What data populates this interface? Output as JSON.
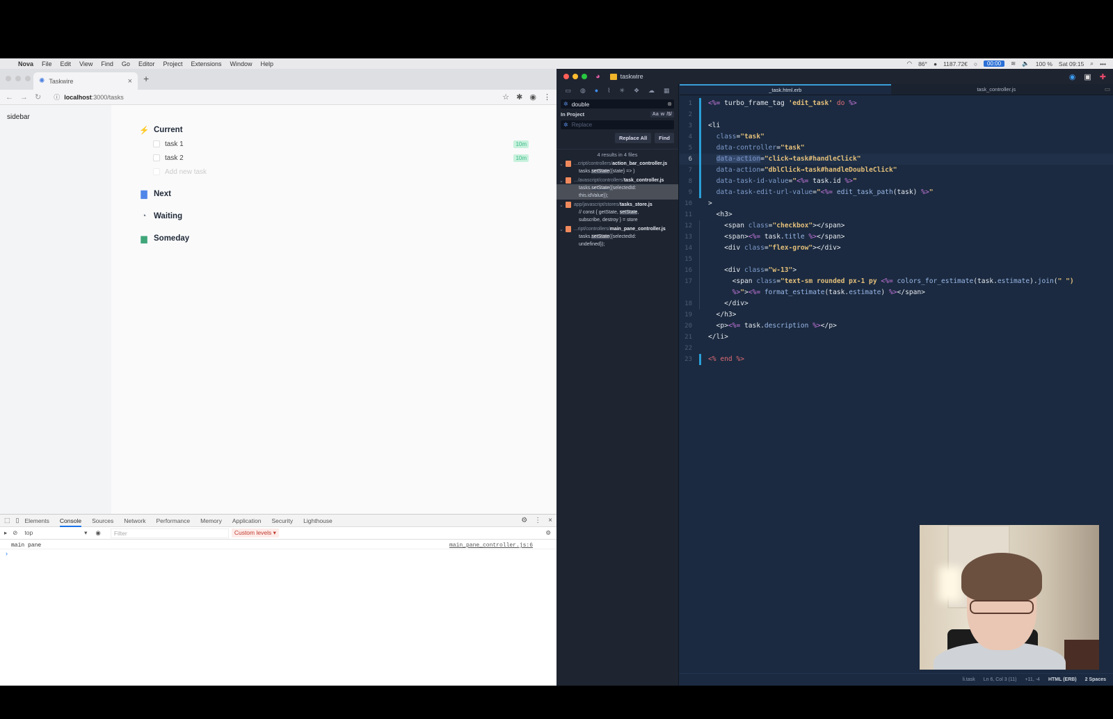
{
  "menubar": {
    "app": "Nova",
    "items": [
      "File",
      "Edit",
      "View",
      "Find",
      "Go",
      "Editor",
      "Project",
      "Extensions",
      "Window",
      "Help"
    ],
    "status": {
      "temp": "86°",
      "price": "1187.72€",
      "timer": "00:00",
      "battery": "100 %",
      "clock": "Sat 09:15"
    }
  },
  "browser": {
    "tab_title": "Taskwire",
    "url_host": "localhost",
    "url_path": ":3000/tasks",
    "sidebar_label": "sidebar",
    "sections": [
      {
        "name": "Current",
        "icon": "lightning-icon",
        "color": "#f5a623"
      },
      {
        "name": "Next",
        "icon": "inbox-stack-icon",
        "color": "#4f86e8"
      },
      {
        "name": "Waiting",
        "icon": "clock-icon",
        "color": "#6b7280"
      },
      {
        "name": "Someday",
        "icon": "calendar-icon",
        "color": "#3fa67a"
      }
    ],
    "tasks": [
      {
        "title": "task 1",
        "estimate": "10m"
      },
      {
        "title": "task 2",
        "estimate": "10m"
      }
    ],
    "add_task_placeholder": "Add new task",
    "devtools": {
      "tabs": [
        "Elements",
        "Console",
        "Sources",
        "Network",
        "Performance",
        "Memory",
        "Application",
        "Security",
        "Lighthouse"
      ],
      "active_tab": "Console",
      "context": "top",
      "filter_placeholder": "Filter",
      "levels": "Custom levels ▾",
      "log": {
        "message": "main pane",
        "source": "main_pane_controller.js:6"
      }
    }
  },
  "nova": {
    "project": "taskwire",
    "find": {
      "query": "double",
      "scope": "In Project",
      "options": [
        "Aa",
        "w",
        "/$/"
      ],
      "replace_placeholder": "Replace",
      "replace_all": "Replace All",
      "find": "Find",
      "summary": "4 results in 4 files",
      "results": [
        {
          "dir": "...cript/controllers/",
          "file": "action_bar_controller.js",
          "lines": [
            [
              "tasks.",
              "setState",
              "({state} => )"
            ]
          ]
        },
        {
          "dir": ".../avascript/controllers/",
          "file": "task_controller.js",
          "lines": [
            [
              "tasks.",
              "setState",
              "({selectedId:"
            ],
            [
              "this.idValue});",
              "",
              ""
            ]
          ]
        },
        {
          "dir": "app/javascript/stores/",
          "file": "tasks_store.js",
          "lines": [
            [
              "// const { getState, ",
              "setState",
              ","
            ],
            [
              "subscribe, destroy } = store",
              "",
              ""
            ]
          ]
        },
        {
          "dir": "...ript/controllers/",
          "file": "main_pane_controller.js",
          "lines": [
            [
              "tasks.",
              "setState",
              "({selectedId:"
            ],
            [
              "undefined});",
              "",
              ""
            ]
          ]
        }
      ]
    },
    "tabs": [
      "_task.html.erb",
      "task_controller.js"
    ],
    "active_tab": "_task.html.erb",
    "status": {
      "symbol": "li.task",
      "position": "Ln 6, Col 3 (11)",
      "diff": "+11, -4",
      "syntax": "HTML (ERB)",
      "indent": "2 Spaces"
    },
    "current_line": 6
  }
}
